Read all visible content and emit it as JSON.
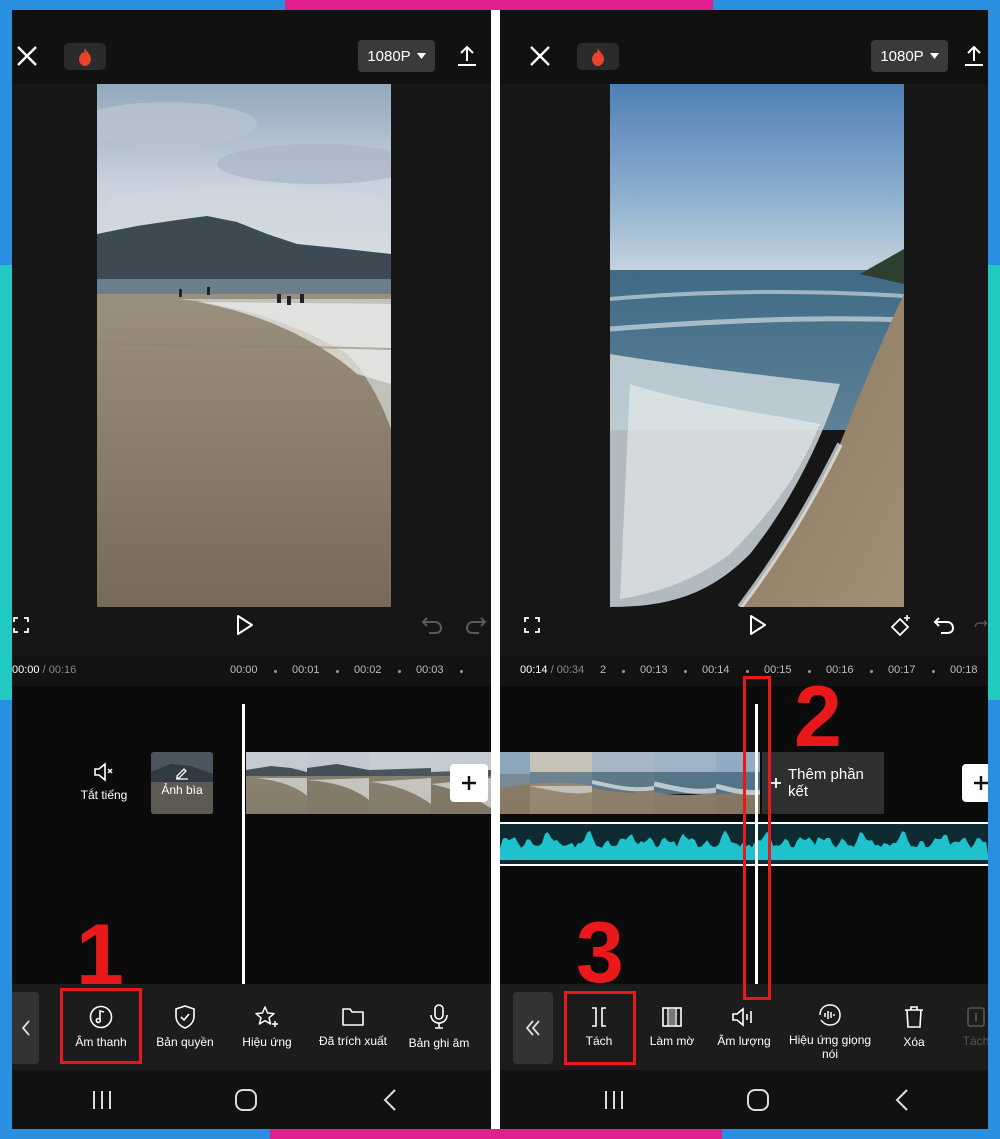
{
  "left": {
    "resolution": "1080P",
    "time_current": "00:00",
    "time_separator": "/",
    "time_total": "00:16",
    "ruler_ticks": [
      "00:00",
      "00:01",
      "00:02",
      "00:03"
    ],
    "mute_label": "Tắt tiếng",
    "cover_label": "Ảnh bìa",
    "tools": [
      "Âm thanh",
      "Bản quyền",
      "Hiệu ứng",
      "Đã trích xuất",
      "Bản ghi âm"
    ],
    "step_number": "1"
  },
  "right": {
    "resolution": "1080P",
    "time_current": "00:14",
    "time_separator": "/",
    "time_total": "00:34",
    "ruler_ticks": [
      "00:13",
      "00:14",
      "00:15",
      "00:16",
      "00:17",
      "00:18"
    ],
    "ruler_partial": "2",
    "add_ending": "Thêm phần kết",
    "add_ending_line1": "Thêm phần",
    "add_ending_line2": "kết",
    "tools": [
      "Tách",
      "Làm mờ",
      "Âm lượng",
      "Hiệu ứng giọng nói",
      "Xóa",
      "Tách"
    ],
    "tool_voice_line1": "Hiệu ứng giọng",
    "tool_voice_line2": "nói",
    "step_split_number": "2",
    "step_tool_number": "3"
  },
  "colors": {
    "frame_blue": "#2a8fe0",
    "frame_pink": "#e21f8f",
    "frame_teal": "#22c9c0",
    "highlight_red": "#e8181b",
    "waveform": "#1fc2cc",
    "fire": "#e8442a"
  },
  "icons": {
    "close": "close-icon",
    "fire": "fire-icon",
    "export": "upload-icon",
    "fullscreen": "fullscreen-icon",
    "play": "play-icon",
    "undo": "undo-icon",
    "redo": "redo-icon",
    "keyframe": "keyframe-icon"
  }
}
